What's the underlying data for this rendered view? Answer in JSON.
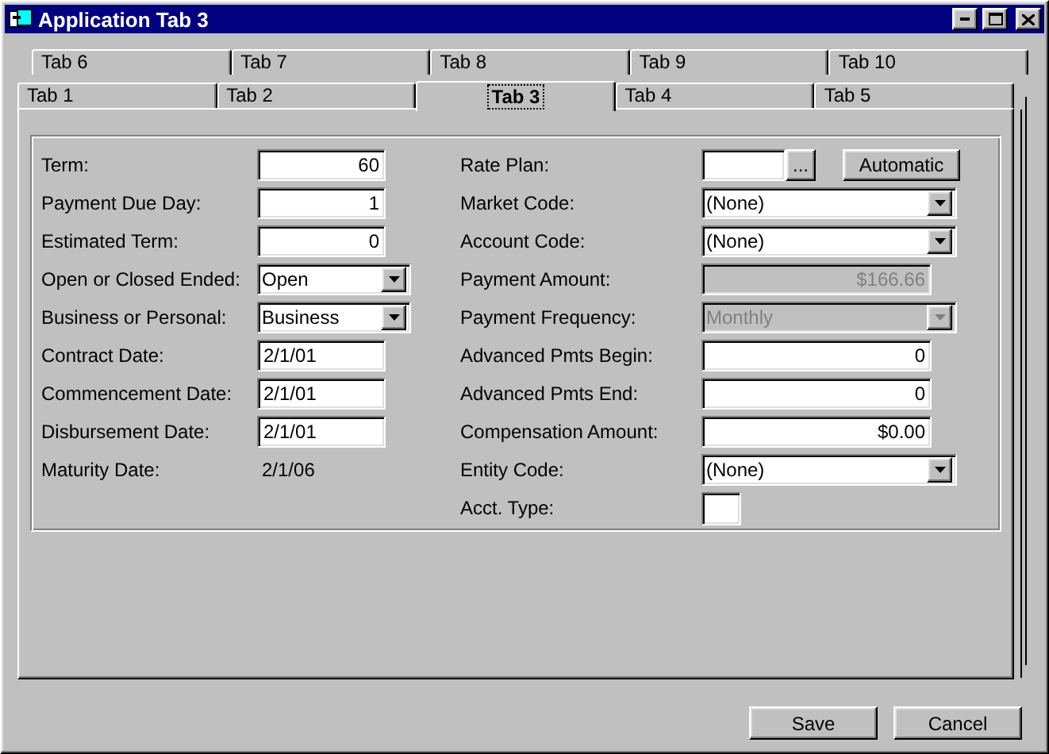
{
  "window": {
    "title": "Application Tab 3"
  },
  "tab_rows": [
    [
      {
        "label": "Tab 6",
        "selected": false
      },
      {
        "label": "Tab 7",
        "selected": false
      },
      {
        "label": "Tab 8",
        "selected": false
      },
      {
        "label": "Tab 9",
        "selected": false
      },
      {
        "label": "Tab 10",
        "selected": false
      }
    ],
    [
      {
        "label": "Tab 1",
        "selected": false
      },
      {
        "label": "Tab 2",
        "selected": false
      },
      {
        "label": "Tab 3",
        "selected": true
      },
      {
        "label": "Tab 4",
        "selected": false
      },
      {
        "label": "Tab 5",
        "selected": false
      }
    ]
  ],
  "left_fields": [
    {
      "label": "Term:",
      "kind": "number",
      "value": "60"
    },
    {
      "label": "Payment Due Day:",
      "kind": "number",
      "value": "1"
    },
    {
      "label": "Estimated Term:",
      "kind": "number",
      "value": "0"
    },
    {
      "label": "Open or Closed Ended:",
      "kind": "dropdown",
      "value": "Open"
    },
    {
      "label": "Business or Personal:",
      "kind": "dropdown",
      "value": "Business"
    },
    {
      "label": "Contract Date:",
      "kind": "date",
      "value": "2/1/01"
    },
    {
      "label": "Commencement Date:",
      "kind": "date",
      "value": "2/1/01"
    },
    {
      "label": "Disbursement Date:",
      "kind": "date",
      "value": "2/1/01"
    },
    {
      "label": "Maturity Date:",
      "kind": "readonly",
      "value": "2/1/06"
    }
  ],
  "right_fields": [
    {
      "label": "Rate Plan:",
      "kind": "lookup",
      "browse": "...",
      "action": "Automatic",
      "disabled": false
    },
    {
      "label": "Market Code:",
      "kind": "dropdown",
      "value": "(None)",
      "disabled": false
    },
    {
      "label": "Account Code:",
      "kind": "dropdown",
      "value": "(None)",
      "disabled": false
    },
    {
      "label": "Payment Amount:",
      "kind": "number",
      "value": "$166.66",
      "disabled": true
    },
    {
      "label": "Payment Frequency:",
      "kind": "dropdown",
      "value": "Monthly",
      "disabled": true
    },
    {
      "label": "Advanced Pmts Begin:",
      "kind": "number",
      "value": "0",
      "disabled": false
    },
    {
      "label": "Advanced Pmts End:",
      "kind": "number",
      "value": "0",
      "disabled": false
    },
    {
      "label": "Compensation Amount:",
      "kind": "number",
      "value": "$0.00",
      "disabled": false
    },
    {
      "label": "Entity Code:",
      "kind": "dropdown",
      "value": "(None)",
      "disabled": false
    },
    {
      "label": "Acct. Type:",
      "kind": "small",
      "disabled": false
    }
  ],
  "buttons": [
    "Save",
    "Cancel"
  ]
}
